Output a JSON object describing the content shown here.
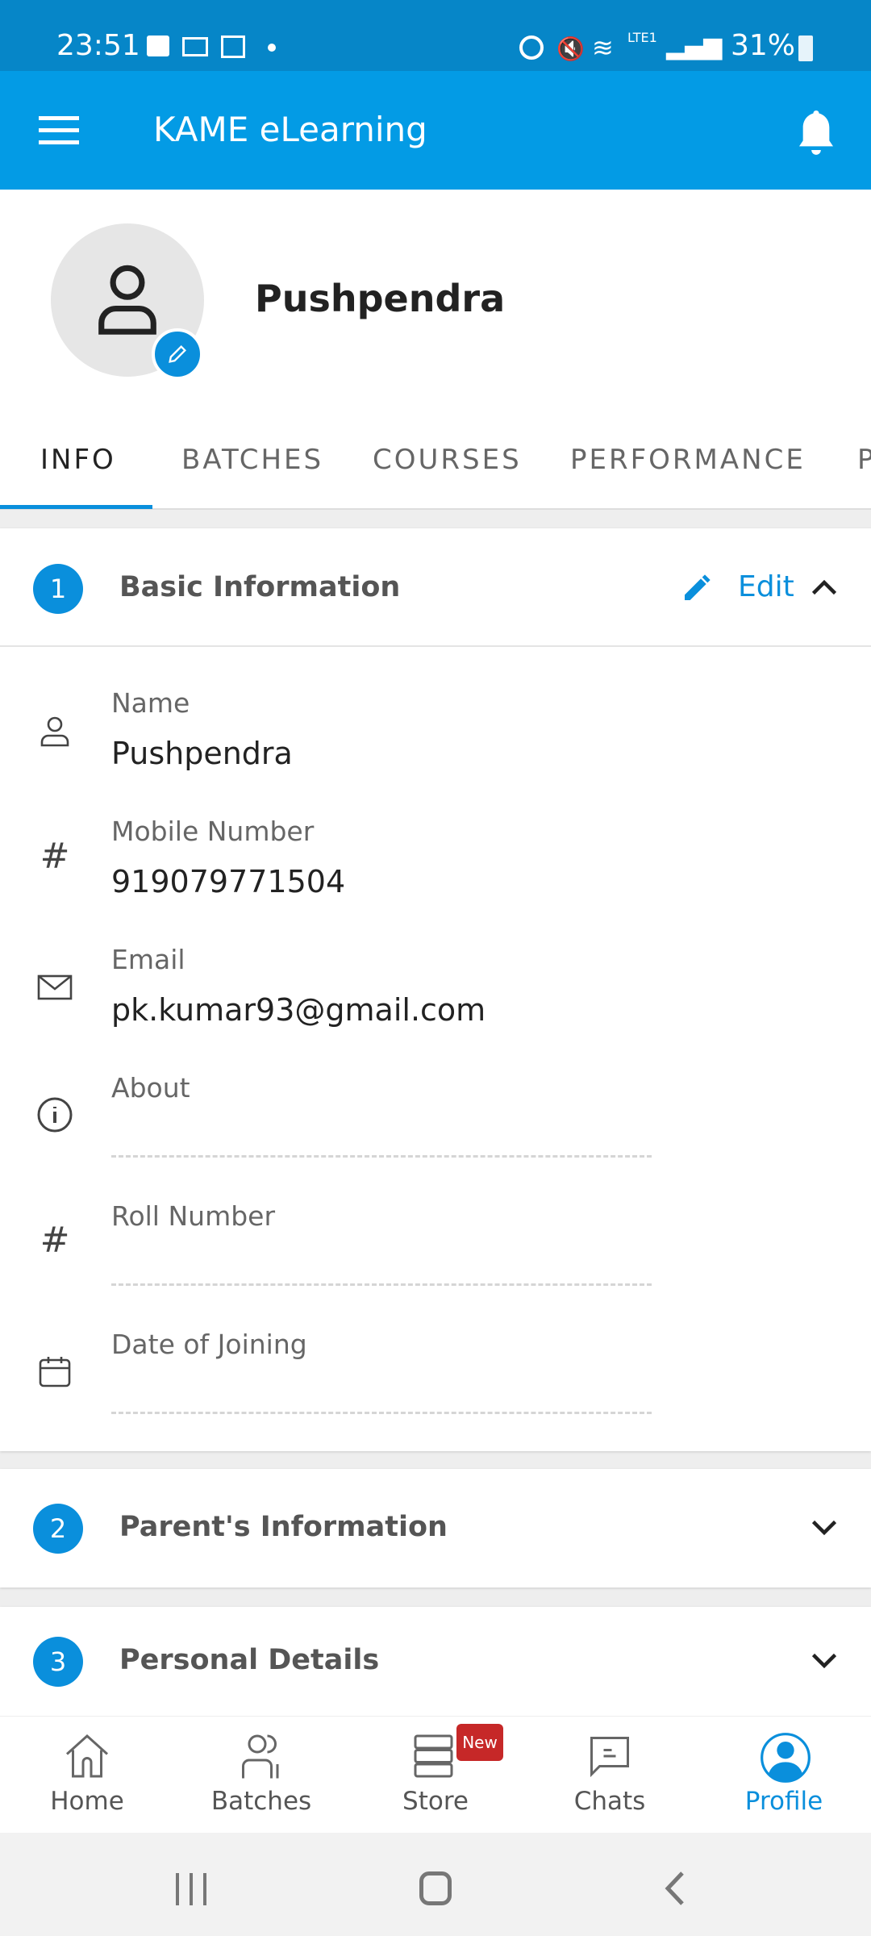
{
  "status_bar": {
    "time": "23:51",
    "battery": "31%",
    "network": "LTE1"
  },
  "app_bar": {
    "title": "KAME eLearning",
    "menu_icon": "hamburger-icon",
    "bell_icon": "bell-icon"
  },
  "profile": {
    "name": "Pushpendra"
  },
  "tabs": [
    {
      "label": "INFO",
      "active": true
    },
    {
      "label": "BATCHES"
    },
    {
      "label": "COURSES"
    },
    {
      "label": "PERFORMANCE"
    },
    {
      "label": "P"
    }
  ],
  "basic_info": {
    "number": "1",
    "title": "Basic Information",
    "edit_label": "Edit",
    "fields": [
      {
        "label": "Name",
        "value": "Pushpendra",
        "icon": "person-icon"
      },
      {
        "label": "Mobile Number",
        "value": "919079771504",
        "icon": "hash-icon"
      },
      {
        "label": "Email",
        "value": "pk.kumar93@gmail.com",
        "icon": "mail-icon"
      },
      {
        "label": "About",
        "value": "",
        "icon": "info-icon"
      },
      {
        "label": "Roll Number",
        "value": "",
        "icon": "hash-icon"
      },
      {
        "label": "Date of Joining",
        "value": "",
        "icon": "calendar-icon"
      }
    ]
  },
  "sections": [
    {
      "number": "2",
      "title": "Parent's Information"
    },
    {
      "number": "3",
      "title": "Personal Details"
    }
  ],
  "bottom_nav": [
    {
      "label": "Home"
    },
    {
      "label": "Batches"
    },
    {
      "label": "Store",
      "badge": "New"
    },
    {
      "label": "Chats"
    },
    {
      "label": "Profile",
      "active": true
    }
  ],
  "colors": {
    "primary": "#039be5",
    "status": "#0686c8",
    "badge": "#c62828"
  }
}
